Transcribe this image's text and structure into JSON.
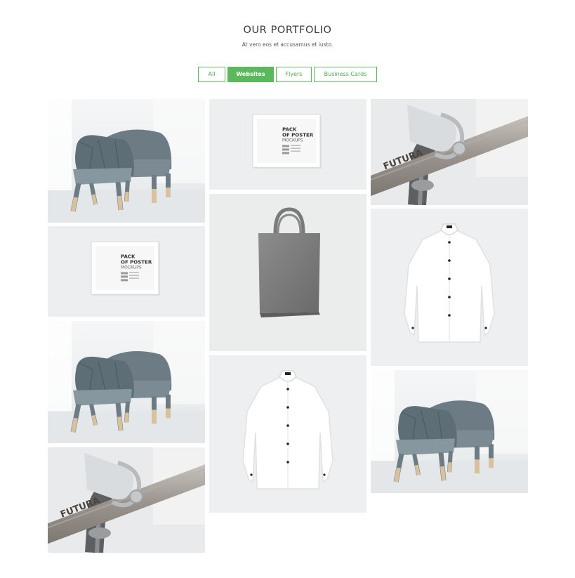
{
  "header": {
    "title": "OUR PORTFOLIO",
    "subtitle": "At vero eos et accusamus et iusto."
  },
  "filters": [
    {
      "label": "All",
      "active": false
    },
    {
      "label": "Websites",
      "active": true
    },
    {
      "label": "Flyers",
      "active": false
    },
    {
      "label": "Business Cards",
      "active": false
    }
  ],
  "colors": {
    "accent": "#5cb85c",
    "background": "#ffffff"
  },
  "poster_text": {
    "line1": "PACK",
    "line2": "OF POSTER",
    "line3": "MOCKUPS"
  },
  "bike_brand": "FUTURA",
  "portfolio": [
    {
      "subject": "chair"
    },
    {
      "subject": "poster-frame"
    },
    {
      "subject": "chair"
    },
    {
      "subject": "bike-handlebar"
    },
    {
      "subject": "poster-frame"
    },
    {
      "subject": "tote-bag"
    },
    {
      "subject": "shirt"
    },
    {
      "subject": "bike-handlebar"
    },
    {
      "subject": "shirt"
    },
    {
      "subject": "chair"
    }
  ]
}
